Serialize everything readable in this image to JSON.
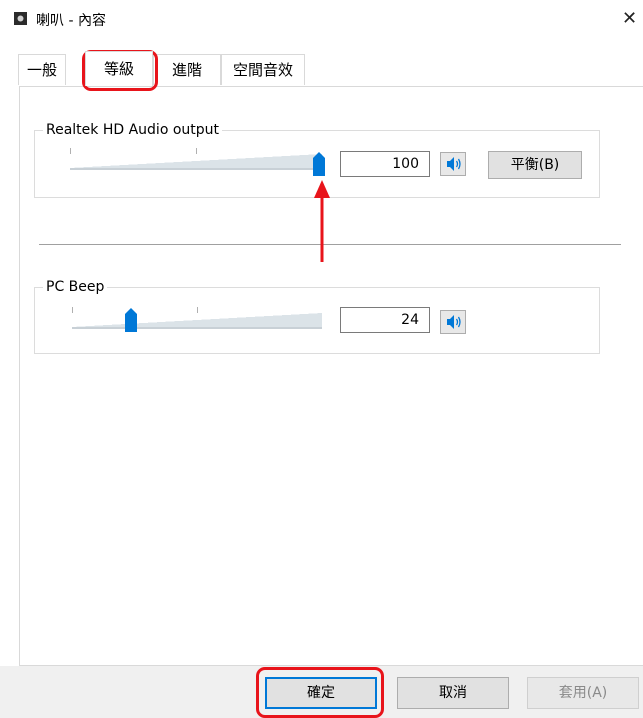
{
  "window": {
    "title": "喇叭 - 內容",
    "close_label": "✕"
  },
  "tabs": [
    {
      "label": "一般"
    },
    {
      "label": "等級",
      "active": true
    },
    {
      "label": "進階"
    },
    {
      "label": "空間音效"
    }
  ],
  "levels": {
    "output": {
      "label": "Realtek HD Audio output",
      "value": "100",
      "level_fraction": 1.0,
      "balance_label": "平衡(B)"
    },
    "beep": {
      "label": "PC Beep",
      "value": "24",
      "level_fraction": 0.24
    }
  },
  "footer": {
    "ok_label": "確定",
    "cancel_label": "取消",
    "apply_label": "套用(A)"
  },
  "colors": {
    "thumb": "#0078d7",
    "annotation": "#e8141b",
    "track": "#dbe3e8"
  }
}
